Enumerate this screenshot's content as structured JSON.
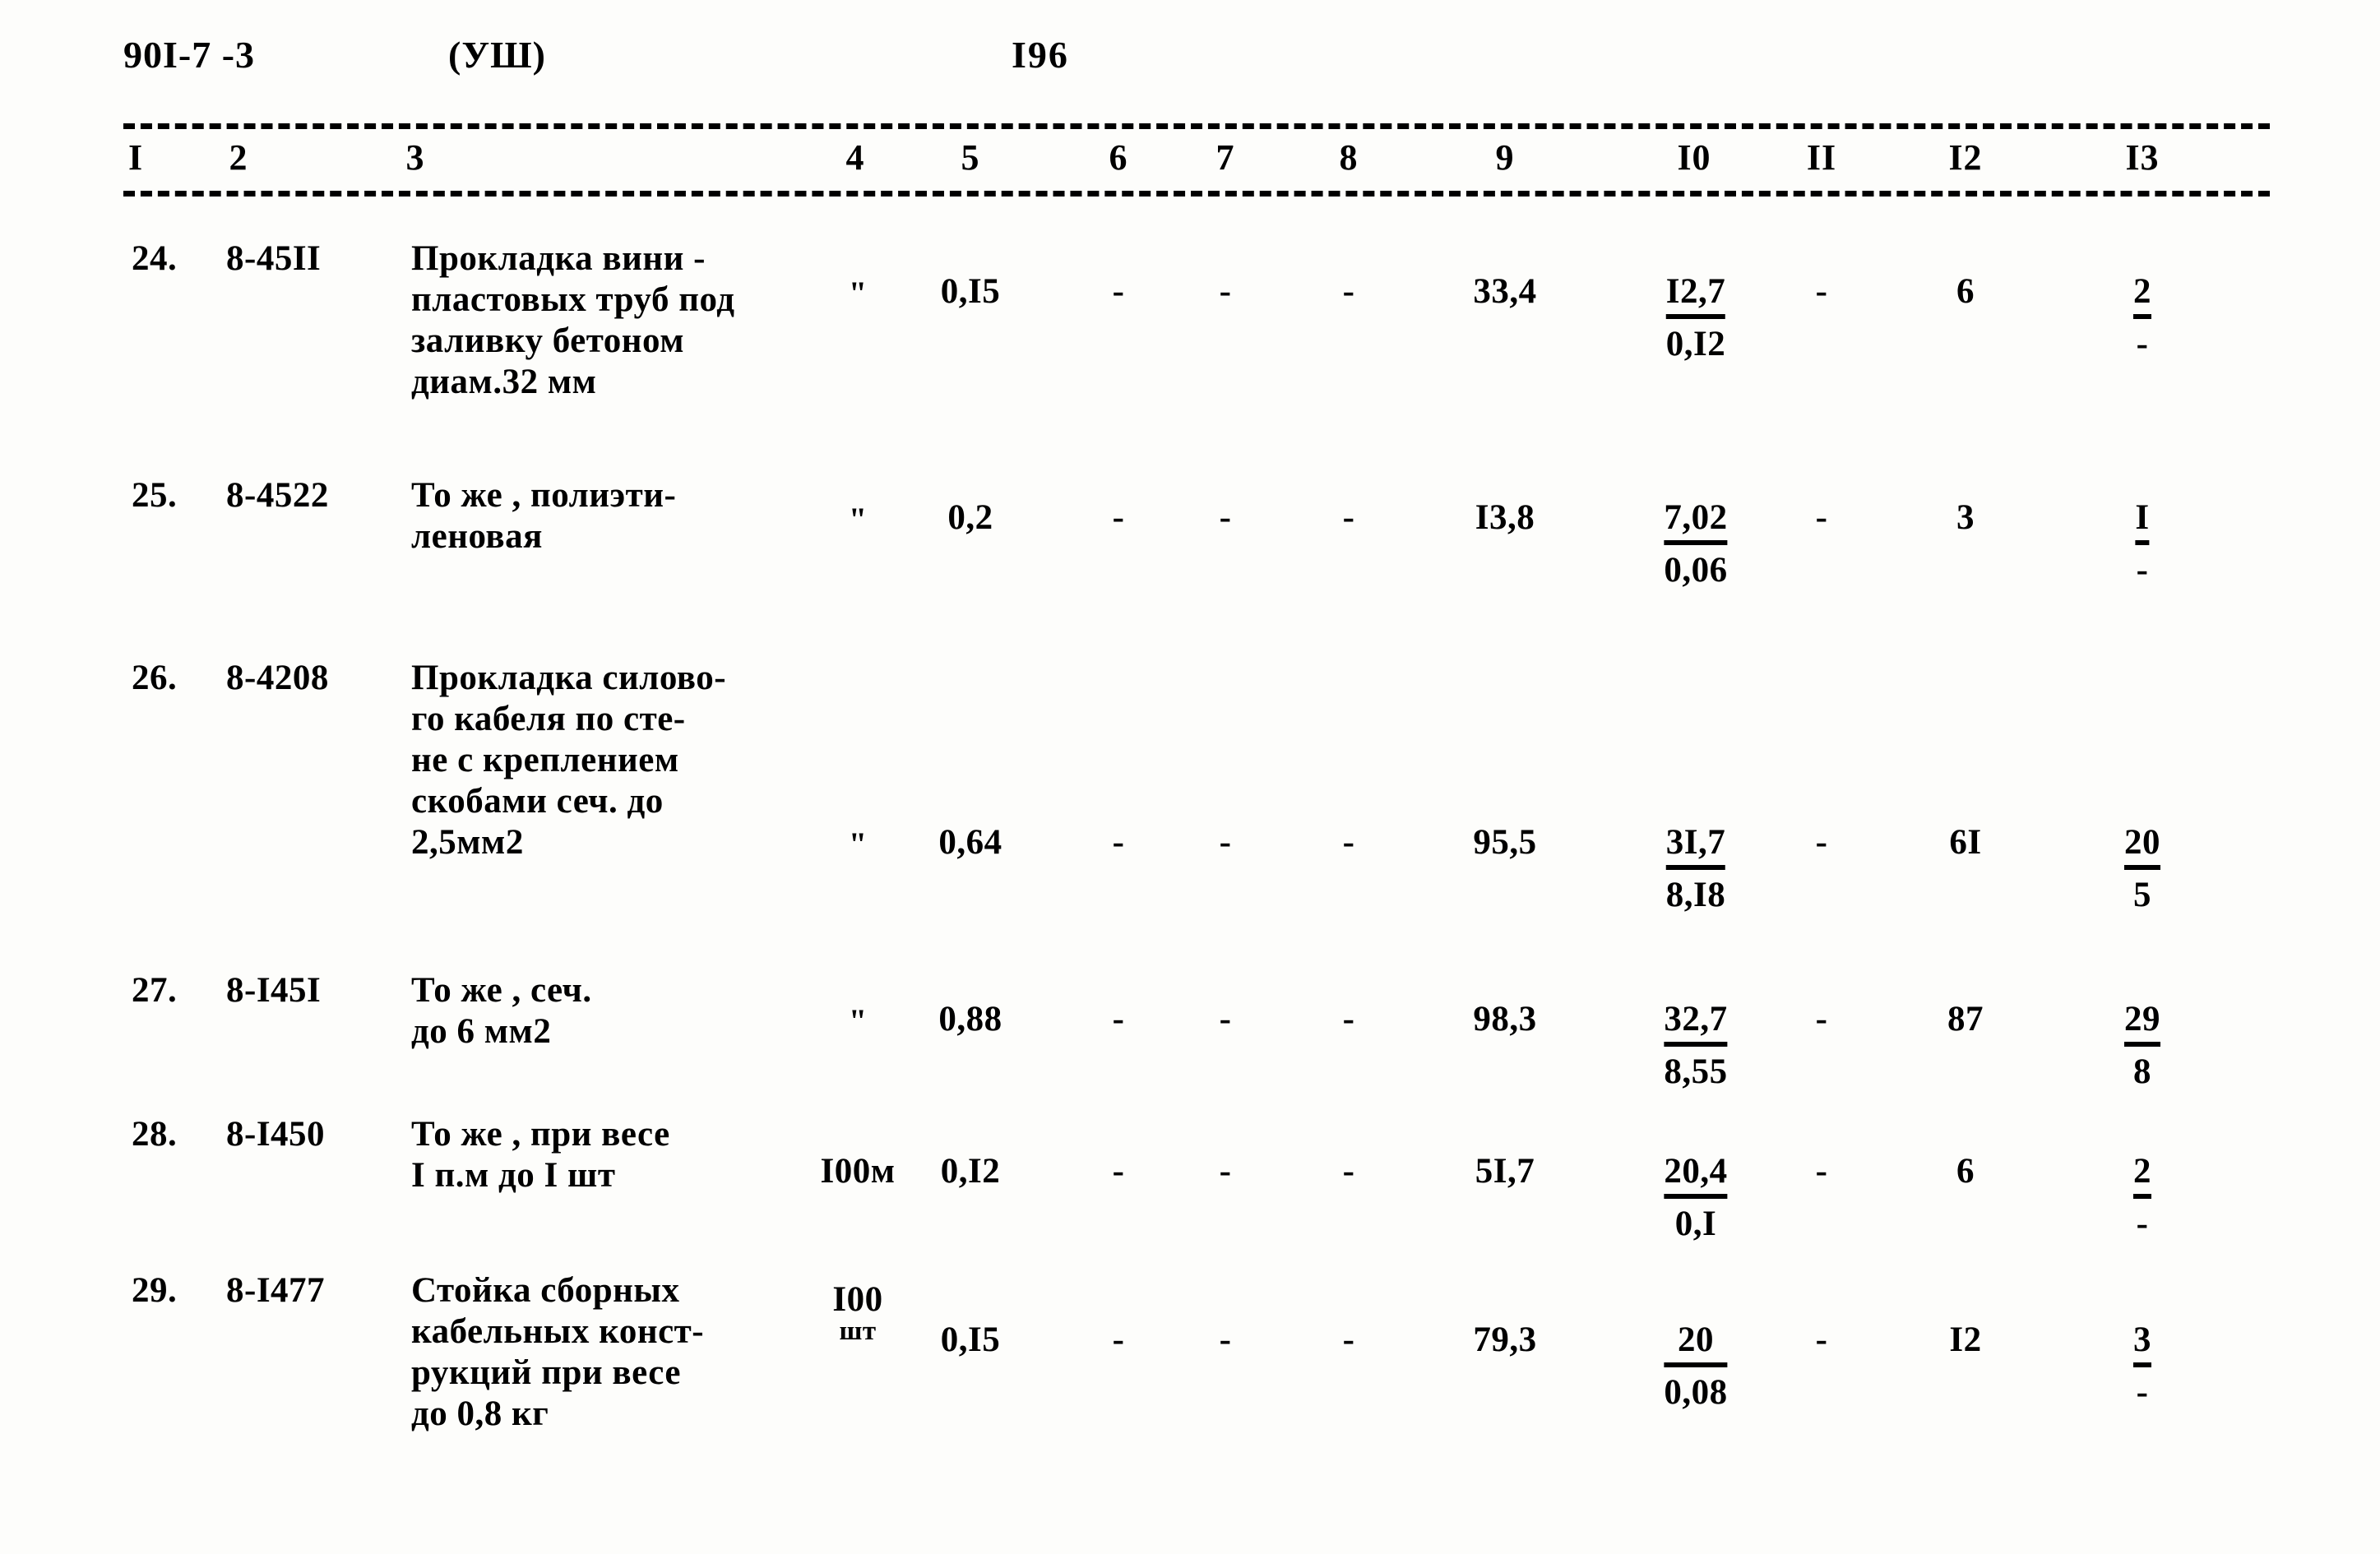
{
  "document": {
    "code": "90I-7 -3",
    "series": "(УШ)",
    "page_number": "I96"
  },
  "table": {
    "column_headers": [
      "I",
      "2",
      "3",
      "4",
      "5",
      "6",
      "7",
      "8",
      "9",
      "I0",
      "II",
      "I2",
      "I3"
    ],
    "rows": [
      {
        "num": "24.",
        "code": "8-45II",
        "description": "Прокладка вини -\nпластовых труб под\nзаливку бетоном\nдиам.32 мм",
        "c4": "\"",
        "c5": "0,I5",
        "c6": "-",
        "c7": "-",
        "c8": "-",
        "c9": "33,4",
        "c10_num": "I2,7",
        "c10_den": "0,I2",
        "c11": "-",
        "c12": "6",
        "c13_num": "2",
        "c13_den": "-"
      },
      {
        "num": "25.",
        "code": "8-4522",
        "description": "То же , полиэти-\nленовая",
        "c4": "\"",
        "c5": "0,2",
        "c6": "-",
        "c7": "-",
        "c8": "-",
        "c9": "I3,8",
        "c10_num": "7,02",
        "c10_den": "0,06",
        "c11": "-",
        "c12": "3",
        "c13_num": "I",
        "c13_den": "-"
      },
      {
        "num": "26.",
        "code": "8-4208",
        "description": "Прокладка силово-\nго кабеля по сте-\nне с креплением\nскобами сеч. до\n2,5мм2",
        "c4": "\"",
        "c5": "0,64",
        "c6": "-",
        "c7": "-",
        "c8": "-",
        "c9": "95,5",
        "c10_num": "3I,7",
        "c10_den": "8,I8",
        "c11": "-",
        "c12": "6I",
        "c13_num": "20",
        "c13_den": "5"
      },
      {
        "num": "27.",
        "code": "8-I45I",
        "description": "То же , сеч.\nдо 6 мм2",
        "c4": "\"",
        "c5": "0,88",
        "c6": "-",
        "c7": "-",
        "c8": "-",
        "c9": "98,3",
        "c10_num": "32,7",
        "c10_den": "8,55",
        "c11": "-",
        "c12": "87",
        "c13_num": "29",
        "c13_den": "8"
      },
      {
        "num": "28.",
        "code": "8-I450",
        "description": "То же , при весе\nI п.м до I шт",
        "c4": "I00м",
        "c5": "0,I2",
        "c6": "-",
        "c7": "-",
        "c8": "-",
        "c9": "5I,7",
        "c10_num": "20,4",
        "c10_den": "0,I",
        "c11": "-",
        "c12": "6",
        "c13_num": "2",
        "c13_den": "-"
      },
      {
        "num": "29.",
        "code": "8-I477",
        "description": "Стойка сборных\nкабельных конст-\nрукций при весе\nдо 0,8 кг",
        "c4": "I00",
        "c4_sub": "шт",
        "c5": "0,I5",
        "c6": "-",
        "c7": "-",
        "c8": "-",
        "c9": "79,3",
        "c10_num": "20",
        "c10_den": "0,08",
        "c11": "-",
        "c12": "I2",
        "c13_num": "3",
        "c13_den": "-"
      }
    ]
  }
}
